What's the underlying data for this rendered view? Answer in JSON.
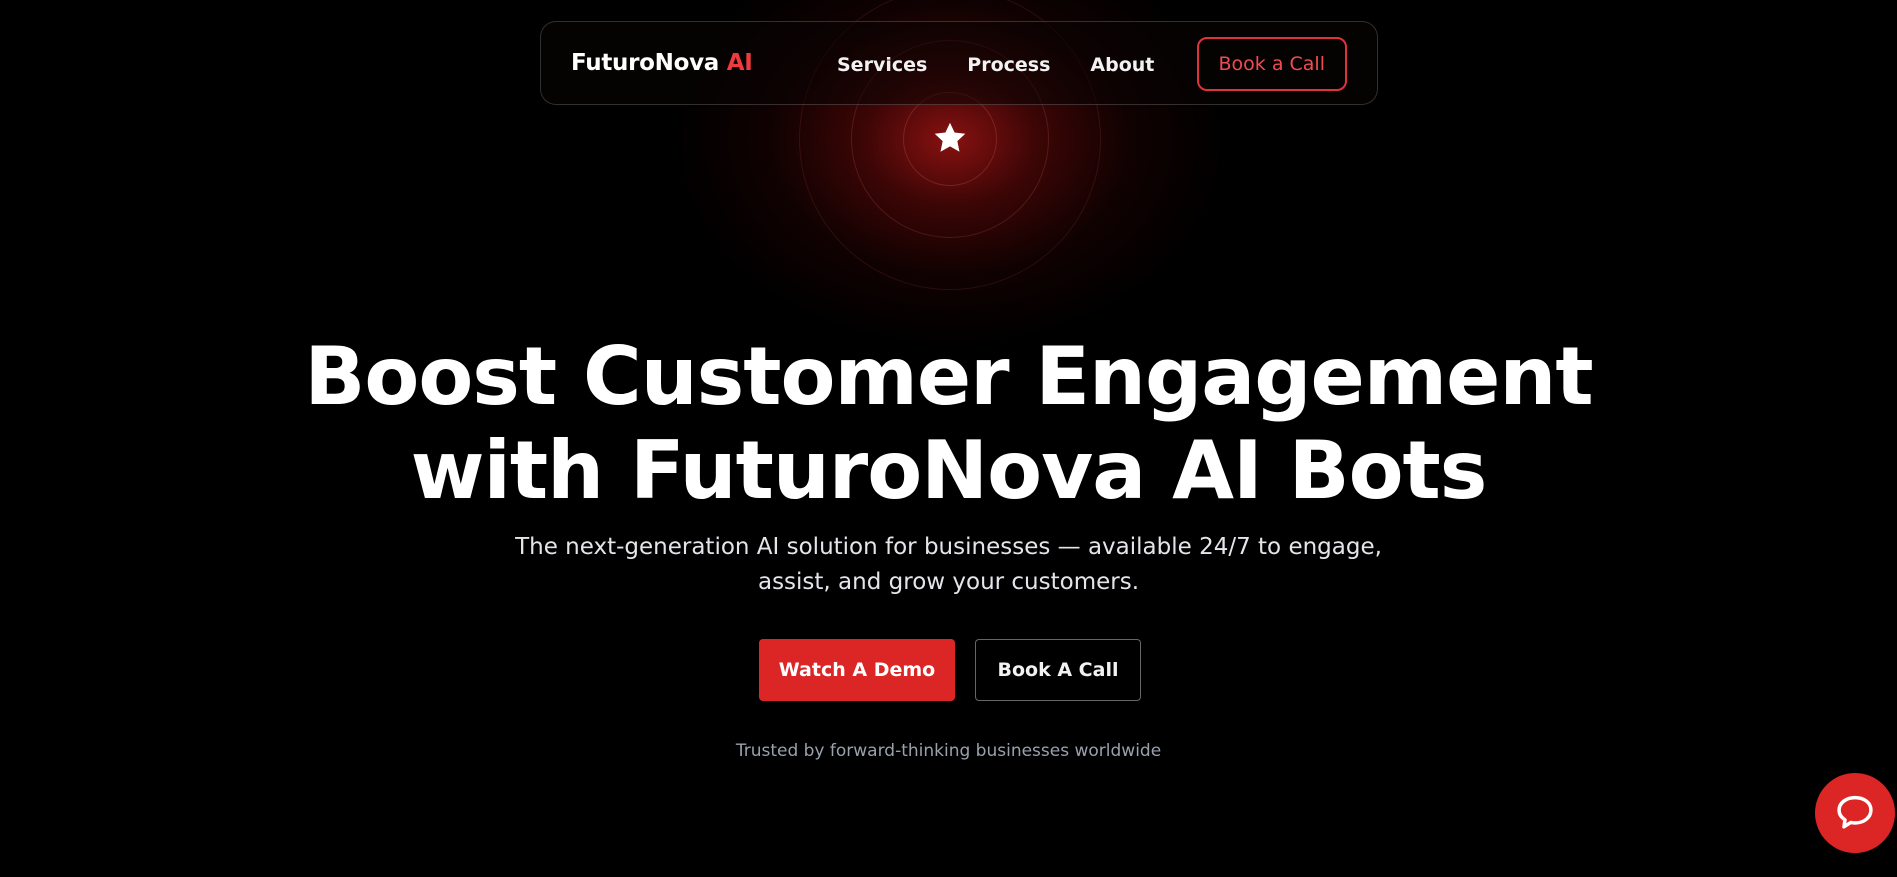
{
  "brand": {
    "name": "FuturoNova",
    "accent": "AI",
    "accent_color": "#ef3b3b"
  },
  "nav": {
    "links": [
      {
        "label": "Services"
      },
      {
        "label": "Process"
      },
      {
        "label": "About"
      }
    ],
    "cta_label": "Book a Call"
  },
  "hero": {
    "icon": "star-icon",
    "title_lines": [
      "Boost Customer Engagement",
      "with FuturoNova AI Bots"
    ],
    "subtitle_lines": [
      "The next-generation AI solution for businesses — available 24/7 to engage,",
      "assist, and grow your customers."
    ],
    "primary_button": "Watch A Demo",
    "secondary_button": "Book A Call",
    "trusted_text": "Trusted by forward-thinking businesses worldwide"
  },
  "chat_widget": {
    "icon": "chat-bubble-icon"
  },
  "colors": {
    "background": "#000000",
    "accent_red": "#dc2626",
    "glow_red": "#a01414"
  }
}
